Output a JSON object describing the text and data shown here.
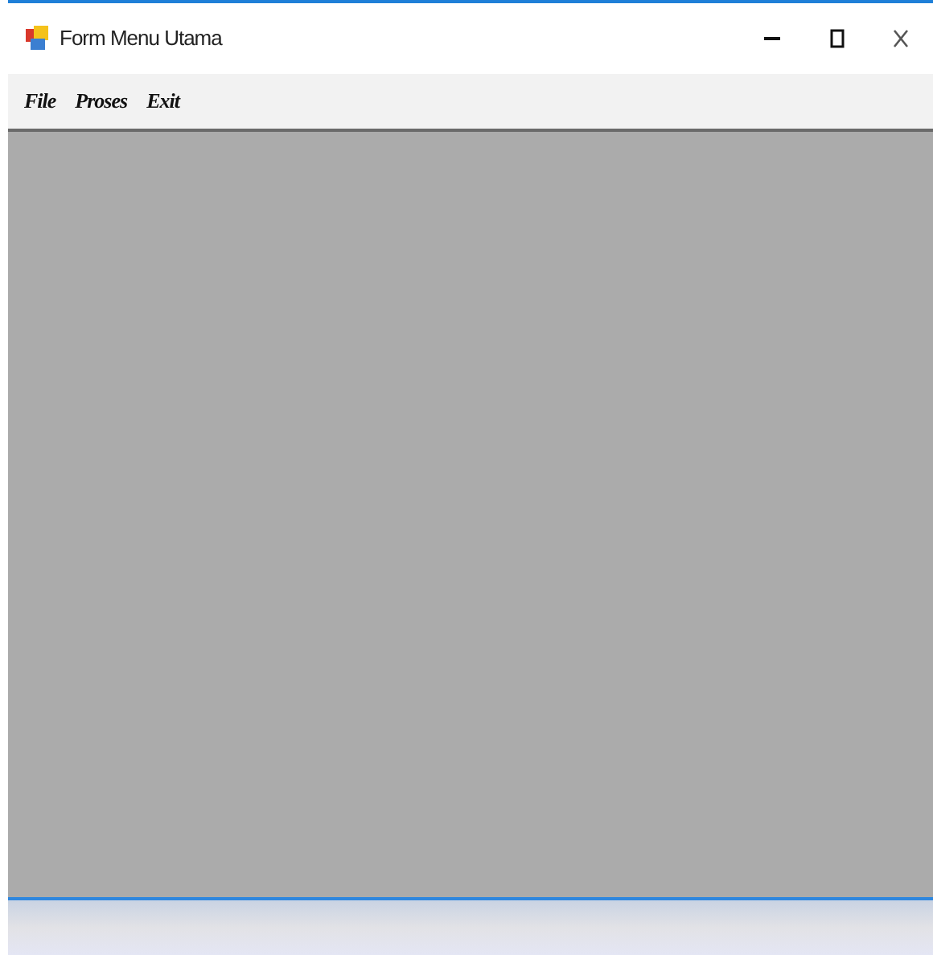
{
  "window": {
    "title": "Form Menu Utama"
  },
  "menu": [
    {
      "label": "File"
    },
    {
      "label": "Proses"
    },
    {
      "label": "Exit"
    }
  ]
}
